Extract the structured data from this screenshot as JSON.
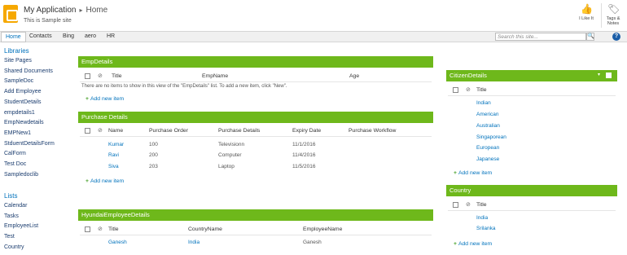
{
  "header": {
    "app_title": "My Application",
    "separator": "▸",
    "page": "Home",
    "subtitle": "This is Sample site",
    "like_label": "I Like It",
    "tags_label_1": "Tags &",
    "tags_label_2": "Notes"
  },
  "nav": {
    "tabs": [
      "Home",
      "Contacts",
      "Bing",
      "aero",
      "HR"
    ],
    "search_placeholder": "Search this site...",
    "search_icon": "🔍",
    "help": "?"
  },
  "sidebar": {
    "libraries_title": "Libraries",
    "libraries": [
      "Site Pages",
      "Shared Documents",
      "SampleDoc",
      "Add Employee",
      "StudentDetails",
      "empdetails1",
      "EmpNewdetails",
      "EMPNew1",
      "StduentDetailsForm",
      "CalForm",
      "Test Doc",
      "Sampledoclib"
    ],
    "lists_title": "Lists",
    "lists": [
      "Calendar",
      "Tasks",
      "EmployeeList",
      "Test",
      "Country"
    ]
  },
  "empdetails": {
    "title": "EmpDetails",
    "columns": [
      "Title",
      "EmpName",
      "Age"
    ],
    "empty_msg": "There are no items to show in this view of the \"EmpDetails\" list. To add a new item, click \"New\".",
    "add": "Add new item"
  },
  "purchase": {
    "title": "Purchase Details",
    "columns": [
      "Name",
      "Purchase Order",
      "Purchase Details",
      "Expiry Date",
      "Purchase Workflow"
    ],
    "rows": [
      [
        "Kumar",
        "100",
        "Televisionn",
        "11/1/2016"
      ],
      [
        "Ravi",
        "200",
        "Computer",
        "11/4/2016"
      ],
      [
        "Siva",
        "203",
        "Laptop",
        "11/5/2016"
      ]
    ],
    "add": "Add new item"
  },
  "hyundai": {
    "title": "HyundaiEmployeeDetails",
    "columns": [
      "Title",
      "CountryName",
      "EmployeeName"
    ],
    "rows": [
      [
        "Ganesh",
        "India",
        "Ganesh"
      ]
    ]
  },
  "citizen": {
    "title": "CitizenDetails",
    "column": "Title",
    "items": [
      "Indian",
      "American",
      "Australian",
      "Singaporean",
      "European",
      "Japanese"
    ],
    "add": "Add new item"
  },
  "country": {
    "title": "Country",
    "column": "Title",
    "items": [
      "India",
      "Srilanka"
    ],
    "add": "Add new item"
  },
  "colors": {
    "accent": "#6eb81b",
    "link": "#0072bc"
  }
}
